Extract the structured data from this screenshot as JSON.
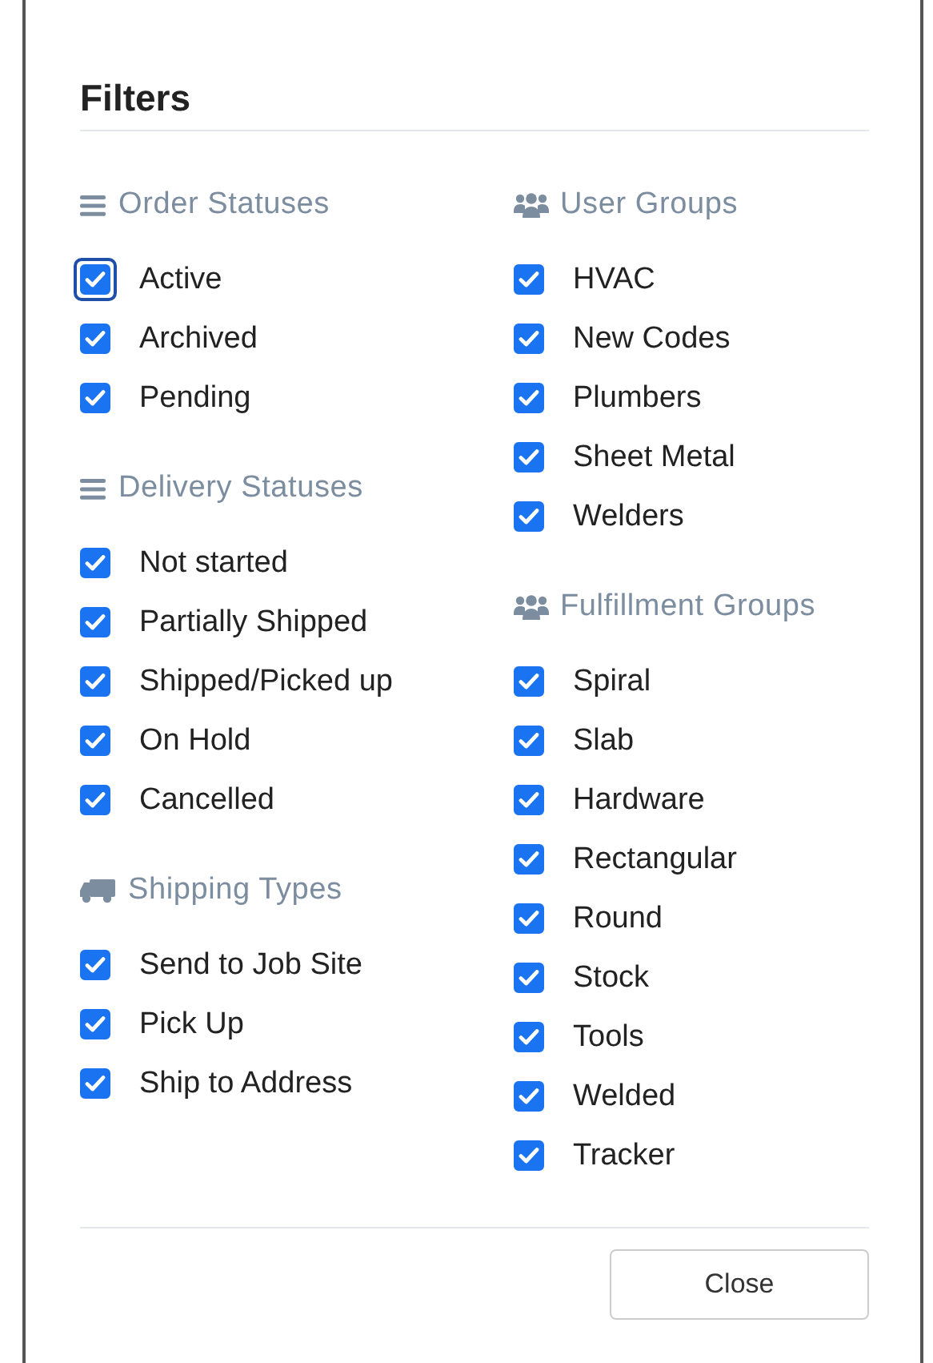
{
  "dialog": {
    "title": "Filters",
    "columns": [
      [
        {
          "kind": "list",
          "title": "Order Statuses",
          "items": [
            {
              "label": "Active",
              "checked": true,
              "focused": true
            },
            {
              "label": "Archived",
              "checked": true,
              "focused": false
            },
            {
              "label": "Pending",
              "checked": true,
              "focused": false
            }
          ]
        },
        {
          "kind": "list",
          "title": "Delivery Statuses",
          "items": [
            {
              "label": "Not started",
              "checked": true,
              "focused": false
            },
            {
              "label": "Partially Shipped",
              "checked": true,
              "focused": false
            },
            {
              "label": "Shipped/Picked up",
              "checked": true,
              "focused": false
            },
            {
              "label": "On Hold",
              "checked": true,
              "focused": false
            },
            {
              "label": "Cancelled",
              "checked": true,
              "focused": false
            }
          ]
        },
        {
          "kind": "truck",
          "title": "Shipping Types",
          "items": [
            {
              "label": "Send to Job Site",
              "checked": true,
              "focused": false
            },
            {
              "label": "Pick Up",
              "checked": true,
              "focused": false
            },
            {
              "label": "Ship to Address",
              "checked": true,
              "focused": false
            }
          ]
        }
      ],
      [
        {
          "kind": "users",
          "title": "User Groups",
          "items": [
            {
              "label": "HVAC",
              "checked": true,
              "focused": false
            },
            {
              "label": "New Codes",
              "checked": true,
              "focused": false
            },
            {
              "label": "Plumbers",
              "checked": true,
              "focused": false
            },
            {
              "label": "Sheet Metal",
              "checked": true,
              "focused": false
            },
            {
              "label": "Welders",
              "checked": true,
              "focused": false
            }
          ]
        },
        {
          "kind": "users",
          "title": "Fulfillment Groups",
          "items": [
            {
              "label": "Spiral",
              "checked": true,
              "focused": false
            },
            {
              "label": "Slab",
              "checked": true,
              "focused": false
            },
            {
              "label": "Hardware",
              "checked": true,
              "focused": false
            },
            {
              "label": "Rectangular",
              "checked": true,
              "focused": false
            },
            {
              "label": "Round",
              "checked": true,
              "focused": false
            },
            {
              "label": "Stock",
              "checked": true,
              "focused": false
            },
            {
              "label": "Tools",
              "checked": true,
              "focused": false
            },
            {
              "label": "Welded",
              "checked": true,
              "focused": false
            },
            {
              "label": "Tracker",
              "checked": true,
              "focused": false
            }
          ]
        }
      ]
    ],
    "button": "Close"
  }
}
